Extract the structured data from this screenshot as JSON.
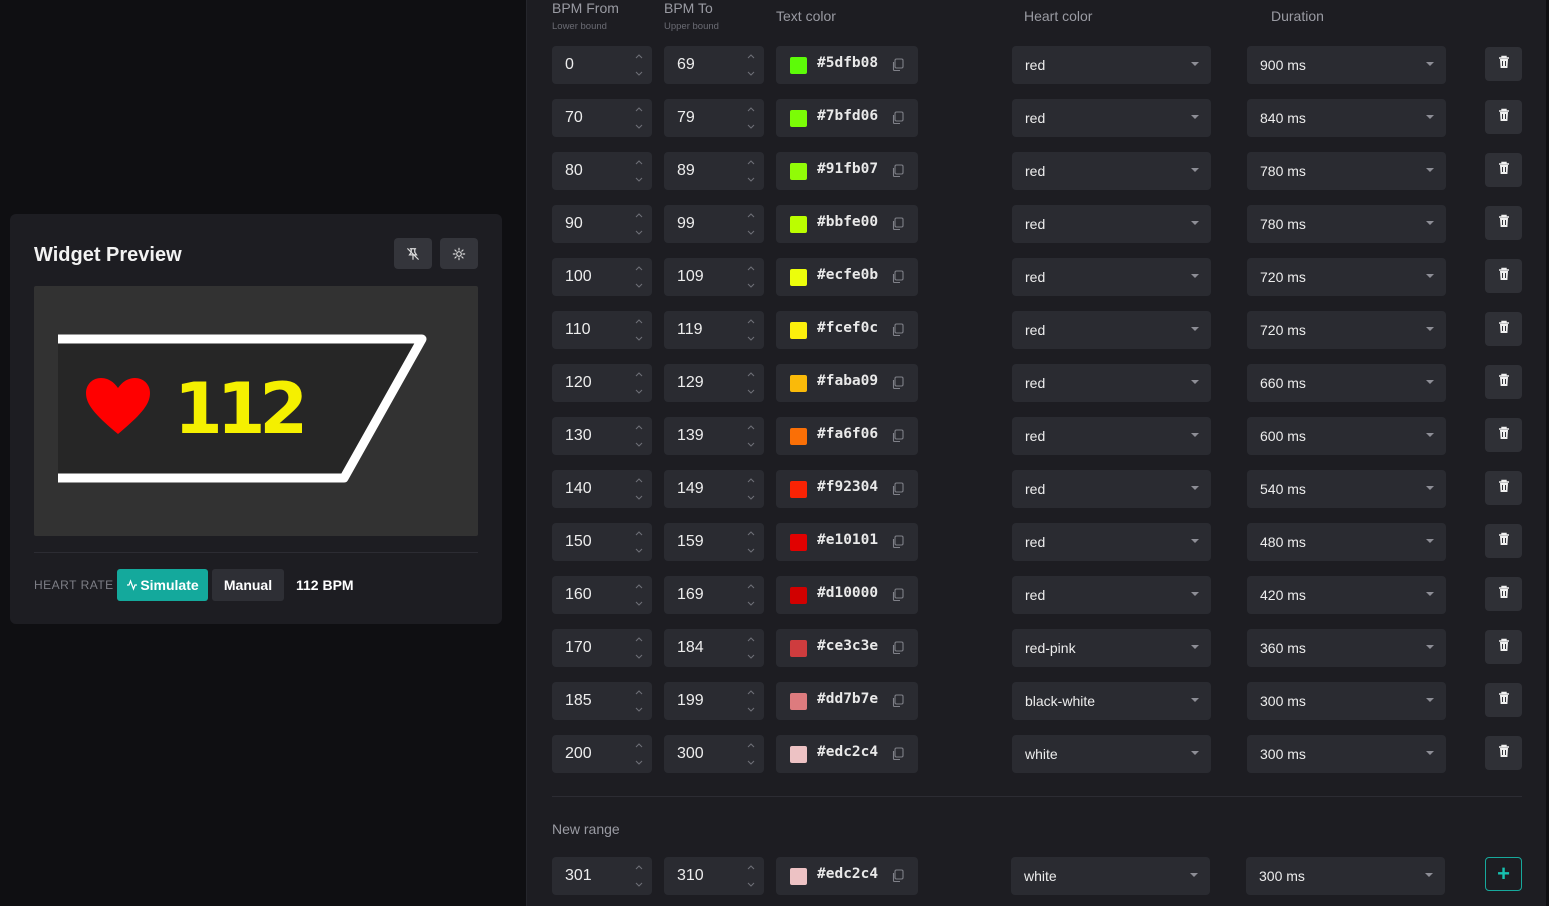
{
  "preview": {
    "title": "Widget Preview",
    "buttons": [
      "pin-off-icon",
      "sun-icon"
    ],
    "widget": {
      "bpm": "112",
      "heart_color": "#ff0000",
      "text_color": "#f5f000"
    },
    "heart_rate_label": "HEART RATE",
    "simulate_label": "Simulate",
    "manual_label": "Manual",
    "bpm_text": "112 BPM"
  },
  "headers": {
    "bpm_from": "BPM From",
    "bpm_from_sub": "Lower bound",
    "bpm_to": "BPM To",
    "bpm_to_sub": "Upper bound",
    "text_color": "Text color",
    "heart_color": "Heart color",
    "duration": "Duration"
  },
  "rows": [
    {
      "from": "0",
      "to": "69",
      "color": "#5dfb08",
      "heart": "red",
      "duration": "900 ms"
    },
    {
      "from": "70",
      "to": "79",
      "color": "#7bfd06",
      "heart": "red",
      "duration": "840 ms"
    },
    {
      "from": "80",
      "to": "89",
      "color": "#91fb07",
      "heart": "red",
      "duration": "780 ms"
    },
    {
      "from": "90",
      "to": "99",
      "color": "#bbfe00",
      "heart": "red",
      "duration": "780 ms"
    },
    {
      "from": "100",
      "to": "109",
      "color": "#ecfe0b",
      "heart": "red",
      "duration": "720 ms"
    },
    {
      "from": "110",
      "to": "119",
      "color": "#fcef0c",
      "heart": "red",
      "duration": "720 ms"
    },
    {
      "from": "120",
      "to": "129",
      "color": "#faba09",
      "heart": "red",
      "duration": "660 ms"
    },
    {
      "from": "130",
      "to": "139",
      "color": "#fa6f06",
      "heart": "red",
      "duration": "600 ms"
    },
    {
      "from": "140",
      "to": "149",
      "color": "#f92304",
      "heart": "red",
      "duration": "540 ms"
    },
    {
      "from": "150",
      "to": "159",
      "color": "#e10101",
      "heart": "red",
      "duration": "480 ms"
    },
    {
      "from": "160",
      "to": "169",
      "color": "#d10000",
      "heart": "red",
      "duration": "420 ms"
    },
    {
      "from": "170",
      "to": "184",
      "color": "#ce3c3e",
      "heart": "red-pink",
      "duration": "360 ms"
    },
    {
      "from": "185",
      "to": "199",
      "color": "#dd7b7e",
      "heart": "black-white",
      "duration": "300 ms"
    },
    {
      "from": "200",
      "to": "300",
      "color": "#edc2c4",
      "heart": "white",
      "duration": "300 ms"
    }
  ],
  "new_range": {
    "label": "New range",
    "from": "301",
    "to": "310",
    "color": "#edc2c4",
    "heart": "white",
    "duration": "300 ms"
  },
  "colors": {
    "accent": "#14a99c",
    "panel": "#1d1d22",
    "input": "#2a2b31"
  }
}
